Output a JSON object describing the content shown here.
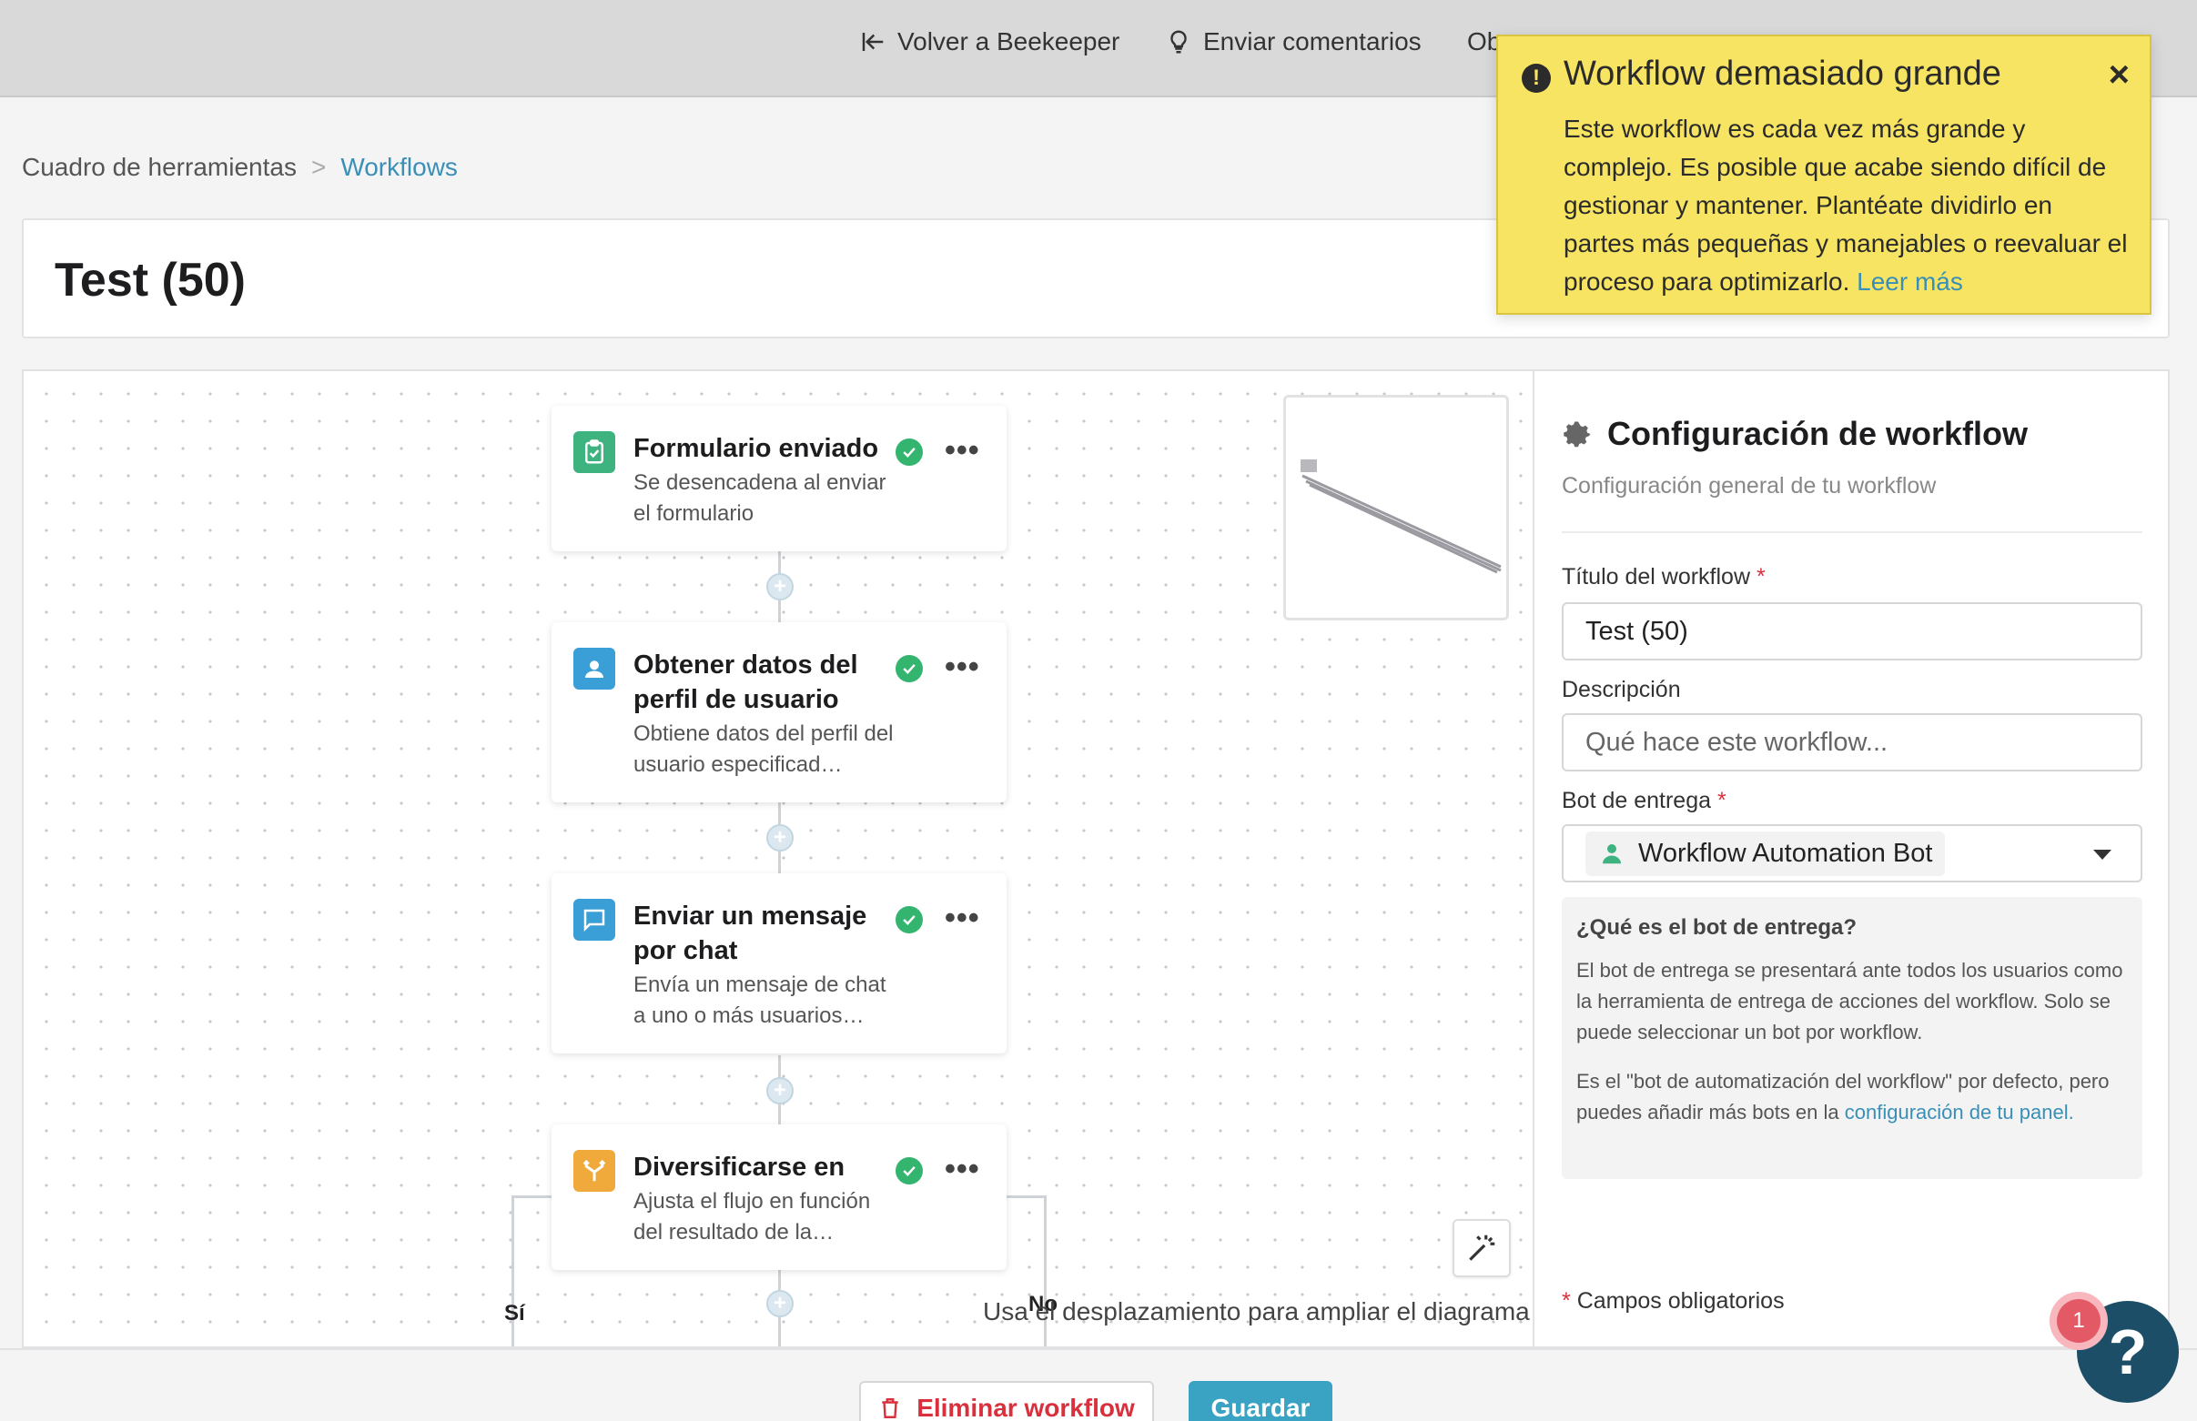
{
  "topbar": {
    "back_label": "Volver a Beekeeper",
    "feedback_label": "Enviar comentarios",
    "partial_label": "Ob"
  },
  "breadcrumb": {
    "root": "Cuadro de herramientas",
    "separator": ">",
    "current": "Workflows"
  },
  "page": {
    "title": "Test (50)"
  },
  "toast": {
    "title": "Workflow demasiado grande",
    "body": "Este workflow es cada vez más grande y complejo. Es posible que acabe siendo difícil de gestionar y mantener. Plantéate dividirlo en partes más pequeñas y manejables o reevaluar el proceso para optimizarlo.",
    "link": "Leer más",
    "close": "×"
  },
  "nodes": [
    {
      "title": "Formulario enviado",
      "desc": "Se desencadena al enviar el formulario",
      "icon": "clipboard-check-icon",
      "color": "#3fb37f"
    },
    {
      "title": "Obtener datos del perfil de usuario",
      "desc": "Obtiene datos del perfil del usuario especificad…",
      "icon": "user-profile-icon",
      "color": "#3a9fd6"
    },
    {
      "title": "Enviar un mensaje por chat",
      "desc": "Envía un mensaje de chat a uno o más usuarios…",
      "icon": "chat-bubble-icon",
      "color": "#3a9fd6"
    },
    {
      "title": "Diversificarse en",
      "desc": "Ajusta el flujo en función del resultado de la…",
      "icon": "branch-icon",
      "color": "#f0a93b"
    }
  ],
  "node_menu": "•••",
  "branches": {
    "yes": "Sí",
    "no": "No"
  },
  "canvas": {
    "zoom_hint": "Usa el desplazamiento para ampliar el diagrama"
  },
  "panel": {
    "title": "Configuración de workflow",
    "subtitle": "Configuración general de tu workflow",
    "title_label": "Título del workflow",
    "title_value": "Test (50)",
    "description_label": "Descripción",
    "description_placeholder": "Qué hace este workflow...",
    "bot_label": "Bot de entrega",
    "bot_value": "Workflow Automation Bot",
    "required_mark": "*",
    "info_title": "¿Qué es el bot de entrega?",
    "info_p1": "El bot de entrega se presentará ante todos los usuarios como la herramienta de entrega de acciones del workflow. Solo se puede seleccionar un bot por workflow.",
    "info_p2_text": "Es el \"bot de automatización del workflow\" por defecto, pero puedes añadir más bots en la ",
    "info_p2_link": "configuración de tu panel.",
    "required_note": "Campos obligatorios"
  },
  "footer": {
    "delete_label": "Eliminar workflow",
    "save_label": "Guardar"
  },
  "help": {
    "badge": "1",
    "icon_label": "?"
  },
  "colors": {
    "accent": "#3aa3c4",
    "danger": "#d9303e",
    "warning_bg": "#f7e463",
    "success": "#33b46f"
  }
}
